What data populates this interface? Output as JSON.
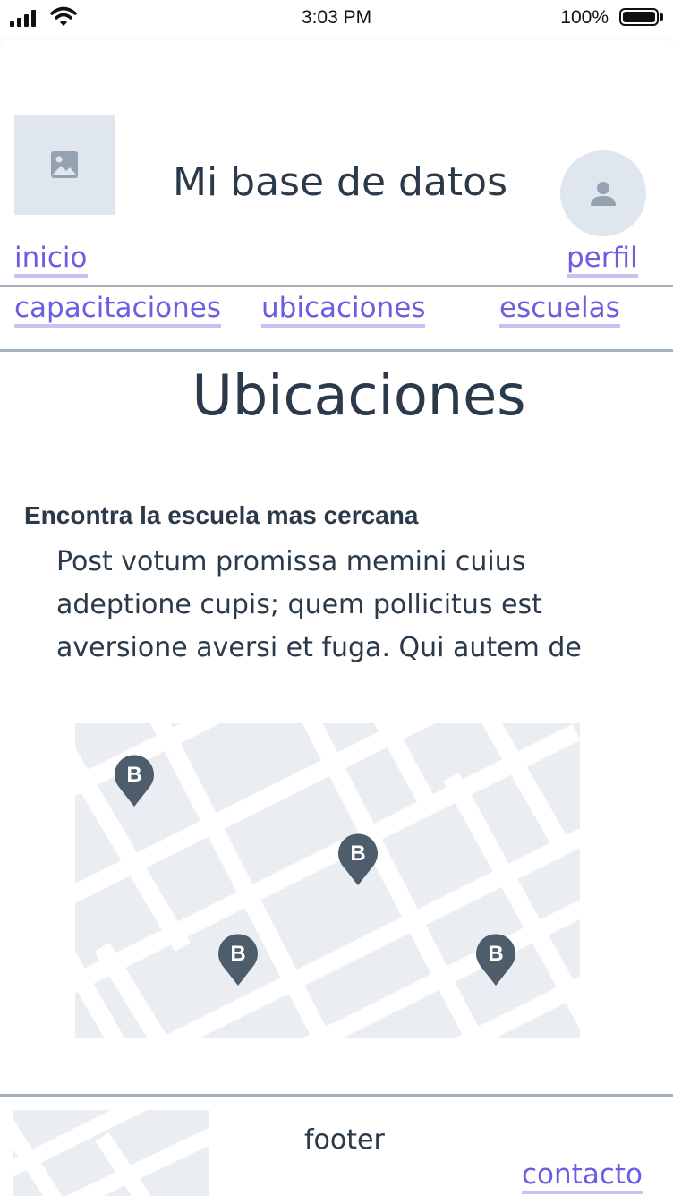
{
  "status_bar": {
    "time": "3:03 PM",
    "battery_text": "100%",
    "battery_level": 1.0,
    "icons": [
      "signal-icon",
      "wifi-icon",
      "battery-icon"
    ]
  },
  "header": {
    "logo_icon": "image-placeholder-icon",
    "title": "Mi base de datos",
    "avatar_icon": "user-icon",
    "home_link": "inicio",
    "profile_link": "perfil"
  },
  "nav": {
    "items": [
      "capacitaciones",
      "ubicaciones",
      "escuelas"
    ]
  },
  "main": {
    "title": "Ubicaciones",
    "subheading": "Encontra la escuela mas cercana",
    "paragraph": "Post votum promissa memini cuius adeptione cupis; quem pollicitus est aversione aversi et fuga. Qui autem de",
    "map": {
      "pins": [
        {
          "label": "B"
        },
        {
          "label": "B"
        },
        {
          "label": "B"
        },
        {
          "label": "B"
        }
      ]
    }
  },
  "footer": {
    "text": "footer",
    "contact_link": "contacto"
  },
  "colors": {
    "text": "#2b3a4a",
    "link": "#6b5ee0",
    "link_underline": "#c8c2f2",
    "divider": "#a5b1bb",
    "placeholder": "#e0e6ee",
    "map_bg": "#eaedf2",
    "pin": "#4e5d6c"
  }
}
